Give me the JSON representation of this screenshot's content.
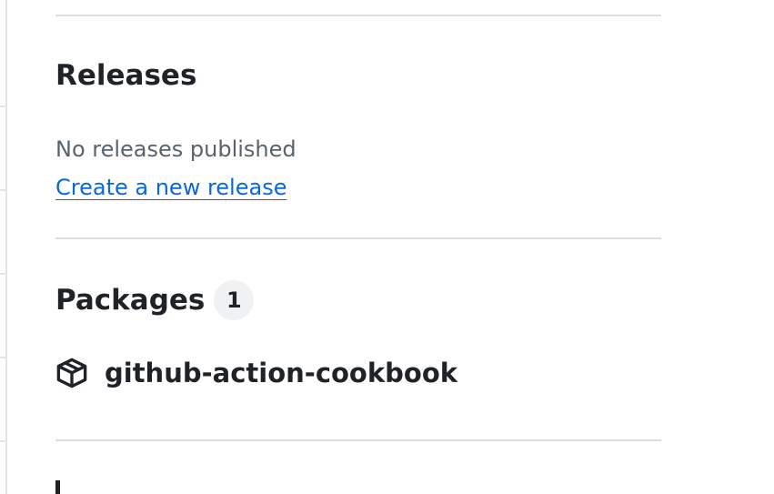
{
  "releases": {
    "heading": "Releases",
    "empty_text": "No releases published",
    "create_link": "Create a new release"
  },
  "packages": {
    "heading": "Packages",
    "count": "1",
    "items": [
      {
        "name": "github-action-cookbook",
        "icon": "package-icon"
      }
    ]
  },
  "colors": {
    "text": "#1f2328",
    "muted": "#59636e",
    "link": "#0969da",
    "divider": "#d8dee4",
    "counter_bg": "#eff1f3"
  }
}
